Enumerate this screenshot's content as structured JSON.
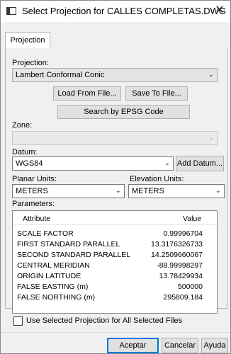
{
  "window": {
    "title": "Select Projection for CALLES COMPLETAS.DWG",
    "close_symbol": "✕"
  },
  "tabs": [
    {
      "label": "Projection"
    }
  ],
  "projection": {
    "label": "Projection:",
    "value": "Lambert Conformal Conic",
    "load_button": "Load From File...",
    "save_button": "Save To File...",
    "epsg_button": "Search by EPSG Code"
  },
  "zone": {
    "label": "Zone:",
    "value": ""
  },
  "datum": {
    "label": "Datum:",
    "value": "WGS84",
    "add_button": "Add Datum..."
  },
  "planar_units": {
    "label": "Planar Units:",
    "value": "METERS"
  },
  "elevation_units": {
    "label": "Elevation Units:",
    "value": "METERS"
  },
  "parameters": {
    "label": "Parameters:",
    "columns": [
      "Attribute",
      "Value"
    ],
    "rows": [
      {
        "name": "SCALE FACTOR",
        "value": "0.99996704"
      },
      {
        "name": "FIRST STANDARD PARALLEL",
        "value": "13.3176326733"
      },
      {
        "name": "SECOND STANDARD PARALLEL",
        "value": "14.2509660067"
      },
      {
        "name": "CENTRAL MERIDIAN",
        "value": "-88.99998297"
      },
      {
        "name": "ORIGIN LATITUDE",
        "value": "13.78429934"
      },
      {
        "name": "FALSE EASTING (m)",
        "value": "500000"
      },
      {
        "name": "FALSE NORTHING (m)",
        "value": "295809.184"
      }
    ]
  },
  "use_for_all": {
    "label": "Use Selected Projection for All Selected Files",
    "checked": false
  },
  "footer": {
    "accept": "Aceptar",
    "cancel": "Cancelar",
    "help": "Ayuda"
  }
}
